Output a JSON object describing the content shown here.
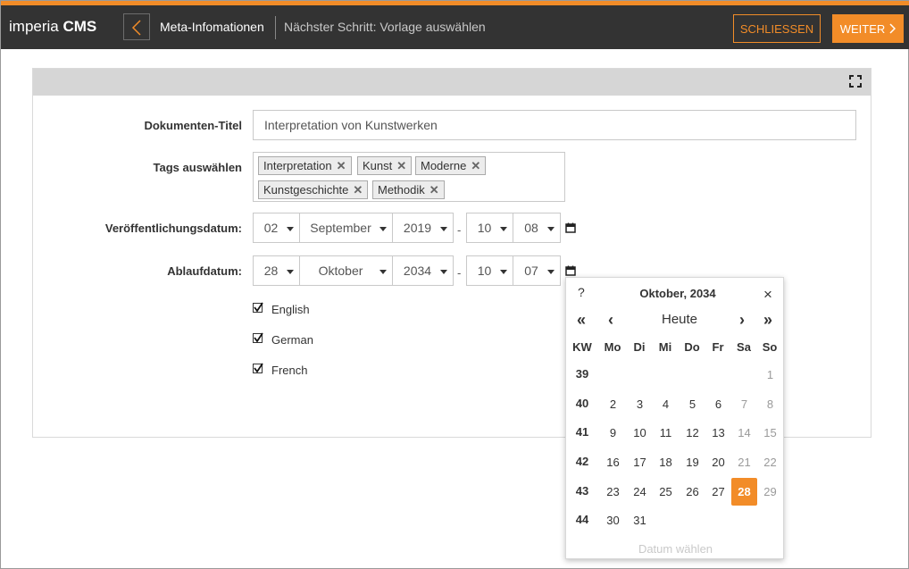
{
  "app": {
    "logo_light": "imperia ",
    "logo_bold": "CMS"
  },
  "header": {
    "crumb": "Meta-Infomationen",
    "next_step": "Nächster Schritt: Vorlage auswählen",
    "close_label": "SCHLIESSEN",
    "next_label": "WEITER",
    "colors": {
      "accent": "#f28c28",
      "bar": "#333333"
    }
  },
  "form": {
    "title_label": "Dokumenten-Titel",
    "title_value": "Interpretation von Kunstwerken",
    "tags_label": "Tags auswählen",
    "tags": [
      "Interpretation",
      "Kunst",
      "Moderne",
      "Kunstgeschichte",
      "Methodik"
    ],
    "pub_label": "Veröffentlichungsdatum:",
    "pub": {
      "day": "02",
      "month": "September",
      "year": "2019",
      "hour": "10",
      "minute": "08"
    },
    "exp_label": "Ablaufdatum:",
    "exp": {
      "day": "28",
      "month": "Oktober",
      "year": "2034",
      "hour": "10",
      "minute": "07"
    },
    "time_sep": "-",
    "languages": [
      {
        "label": "English",
        "checked": true
      },
      {
        "label": "German",
        "checked": true
      },
      {
        "label": "French",
        "checked": true
      }
    ]
  },
  "datepicker": {
    "help": "?",
    "title": "Oktober, 2034",
    "close": "×",
    "nav_prev_year": "«",
    "nav_prev": "‹",
    "today": "Heute",
    "nav_next": "›",
    "nav_next_year": "»",
    "headers": [
      "KW",
      "Mo",
      "Di",
      "Mi",
      "Do",
      "Fr",
      "Sa",
      "So"
    ],
    "weeks": [
      {
        "kw": "39",
        "days": [
          "",
          "",
          "",
          "",
          "",
          "1"
        ]
      },
      {
        "kw": "40",
        "days": [
          "2",
          "3",
          "4",
          "5",
          "6",
          "7",
          "8"
        ]
      },
      {
        "kw": "41",
        "days": [
          "9",
          "10",
          "11",
          "12",
          "13",
          "14",
          "15"
        ]
      },
      {
        "kw": "42",
        "days": [
          "16",
          "17",
          "18",
          "19",
          "20",
          "21",
          "22"
        ]
      },
      {
        "kw": "43",
        "days": [
          "23",
          "24",
          "25",
          "26",
          "27",
          "28",
          "29"
        ]
      },
      {
        "kw": "44",
        "days": [
          "30",
          "31"
        ]
      }
    ],
    "selected": "28",
    "footer": "Datum wählen"
  }
}
